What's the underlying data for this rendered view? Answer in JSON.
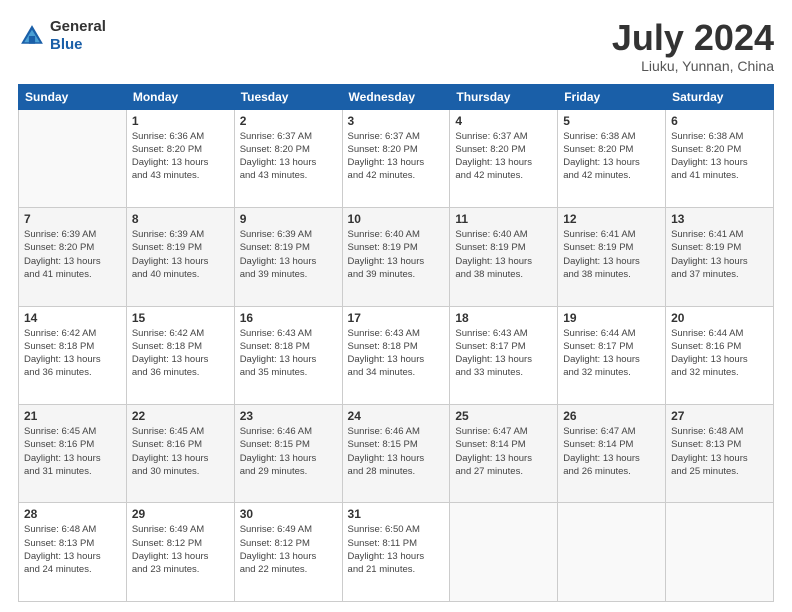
{
  "header": {
    "logo_general": "General",
    "logo_blue": "Blue",
    "month_title": "July 2024",
    "location": "Liuku, Yunnan, China"
  },
  "days_of_week": [
    "Sunday",
    "Monday",
    "Tuesday",
    "Wednesday",
    "Thursday",
    "Friday",
    "Saturday"
  ],
  "weeks": [
    [
      {
        "day": "",
        "info": ""
      },
      {
        "day": "1",
        "info": "Sunrise: 6:36 AM\nSunset: 8:20 PM\nDaylight: 13 hours\nand 43 minutes."
      },
      {
        "day": "2",
        "info": "Sunrise: 6:37 AM\nSunset: 8:20 PM\nDaylight: 13 hours\nand 43 minutes."
      },
      {
        "day": "3",
        "info": "Sunrise: 6:37 AM\nSunset: 8:20 PM\nDaylight: 13 hours\nand 42 minutes."
      },
      {
        "day": "4",
        "info": "Sunrise: 6:37 AM\nSunset: 8:20 PM\nDaylight: 13 hours\nand 42 minutes."
      },
      {
        "day": "5",
        "info": "Sunrise: 6:38 AM\nSunset: 8:20 PM\nDaylight: 13 hours\nand 42 minutes."
      },
      {
        "day": "6",
        "info": "Sunrise: 6:38 AM\nSunset: 8:20 PM\nDaylight: 13 hours\nand 41 minutes."
      }
    ],
    [
      {
        "day": "7",
        "info": "Sunrise: 6:39 AM\nSunset: 8:20 PM\nDaylight: 13 hours\nand 41 minutes."
      },
      {
        "day": "8",
        "info": "Sunrise: 6:39 AM\nSunset: 8:19 PM\nDaylight: 13 hours\nand 40 minutes."
      },
      {
        "day": "9",
        "info": "Sunrise: 6:39 AM\nSunset: 8:19 PM\nDaylight: 13 hours\nand 39 minutes."
      },
      {
        "day": "10",
        "info": "Sunrise: 6:40 AM\nSunset: 8:19 PM\nDaylight: 13 hours\nand 39 minutes."
      },
      {
        "day": "11",
        "info": "Sunrise: 6:40 AM\nSunset: 8:19 PM\nDaylight: 13 hours\nand 38 minutes."
      },
      {
        "day": "12",
        "info": "Sunrise: 6:41 AM\nSunset: 8:19 PM\nDaylight: 13 hours\nand 38 minutes."
      },
      {
        "day": "13",
        "info": "Sunrise: 6:41 AM\nSunset: 8:19 PM\nDaylight: 13 hours\nand 37 minutes."
      }
    ],
    [
      {
        "day": "14",
        "info": "Sunrise: 6:42 AM\nSunset: 8:18 PM\nDaylight: 13 hours\nand 36 minutes."
      },
      {
        "day": "15",
        "info": "Sunrise: 6:42 AM\nSunset: 8:18 PM\nDaylight: 13 hours\nand 36 minutes."
      },
      {
        "day": "16",
        "info": "Sunrise: 6:43 AM\nSunset: 8:18 PM\nDaylight: 13 hours\nand 35 minutes."
      },
      {
        "day": "17",
        "info": "Sunrise: 6:43 AM\nSunset: 8:18 PM\nDaylight: 13 hours\nand 34 minutes."
      },
      {
        "day": "18",
        "info": "Sunrise: 6:43 AM\nSunset: 8:17 PM\nDaylight: 13 hours\nand 33 minutes."
      },
      {
        "day": "19",
        "info": "Sunrise: 6:44 AM\nSunset: 8:17 PM\nDaylight: 13 hours\nand 32 minutes."
      },
      {
        "day": "20",
        "info": "Sunrise: 6:44 AM\nSunset: 8:16 PM\nDaylight: 13 hours\nand 32 minutes."
      }
    ],
    [
      {
        "day": "21",
        "info": "Sunrise: 6:45 AM\nSunset: 8:16 PM\nDaylight: 13 hours\nand 31 minutes."
      },
      {
        "day": "22",
        "info": "Sunrise: 6:45 AM\nSunset: 8:16 PM\nDaylight: 13 hours\nand 30 minutes."
      },
      {
        "day": "23",
        "info": "Sunrise: 6:46 AM\nSunset: 8:15 PM\nDaylight: 13 hours\nand 29 minutes."
      },
      {
        "day": "24",
        "info": "Sunrise: 6:46 AM\nSunset: 8:15 PM\nDaylight: 13 hours\nand 28 minutes."
      },
      {
        "day": "25",
        "info": "Sunrise: 6:47 AM\nSunset: 8:14 PM\nDaylight: 13 hours\nand 27 minutes."
      },
      {
        "day": "26",
        "info": "Sunrise: 6:47 AM\nSunset: 8:14 PM\nDaylight: 13 hours\nand 26 minutes."
      },
      {
        "day": "27",
        "info": "Sunrise: 6:48 AM\nSunset: 8:13 PM\nDaylight: 13 hours\nand 25 minutes."
      }
    ],
    [
      {
        "day": "28",
        "info": "Sunrise: 6:48 AM\nSunset: 8:13 PM\nDaylight: 13 hours\nand 24 minutes."
      },
      {
        "day": "29",
        "info": "Sunrise: 6:49 AM\nSunset: 8:12 PM\nDaylight: 13 hours\nand 23 minutes."
      },
      {
        "day": "30",
        "info": "Sunrise: 6:49 AM\nSunset: 8:12 PM\nDaylight: 13 hours\nand 22 minutes."
      },
      {
        "day": "31",
        "info": "Sunrise: 6:50 AM\nSunset: 8:11 PM\nDaylight: 13 hours\nand 21 minutes."
      },
      {
        "day": "",
        "info": ""
      },
      {
        "day": "",
        "info": ""
      },
      {
        "day": "",
        "info": ""
      }
    ]
  ]
}
